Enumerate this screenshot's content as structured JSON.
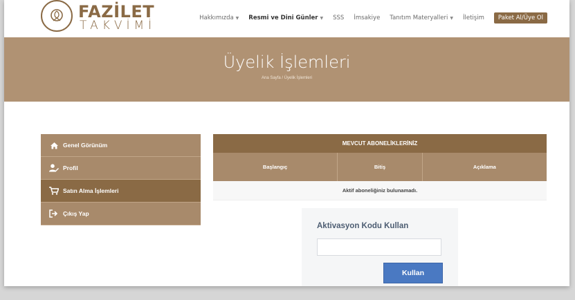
{
  "brand": {
    "title": "FAZİLET",
    "subtitle": "TAKVİMİ"
  },
  "nav": {
    "items": [
      {
        "label": "Hakkımızda",
        "dropdown": true,
        "bold": false
      },
      {
        "label": "Resmi ve Dini Günler",
        "dropdown": true,
        "bold": true
      },
      {
        "label": "SSS",
        "dropdown": false,
        "bold": false
      },
      {
        "label": "İmsakiye",
        "dropdown": false,
        "bold": false
      },
      {
        "label": "Tanıtım Materyalleri",
        "dropdown": true,
        "bold": false
      },
      {
        "label": "İletişim",
        "dropdown": false,
        "bold": false
      }
    ],
    "cta_label": "Paket Al/Üye Ol"
  },
  "hero": {
    "title": "Üyelik İşlemleri",
    "breadcrumb": "Ana Sayfa / Üyelik İşlemleri"
  },
  "sidebar": {
    "items": [
      {
        "label": "Genel Görünüm",
        "icon": "home-icon",
        "active": false
      },
      {
        "label": "Profil",
        "icon": "user-edit-icon",
        "active": false
      },
      {
        "label": "Satın Alma İşlemleri",
        "icon": "cart-icon",
        "active": true
      },
      {
        "label": "Çıkış Yap",
        "icon": "sign-out-icon",
        "active": false
      }
    ]
  },
  "subscriptions": {
    "title": "MEVCUT ABONELİKLERİNİZ",
    "columns": [
      "Başlangıç",
      "Bitiş",
      "Açıklama"
    ],
    "empty_message": "Aktif aboneliğiniz bulunamadı."
  },
  "activation": {
    "title": "Aktivasyon Kodu Kullan",
    "input_value": "",
    "button_label": "Kullan"
  },
  "colors": {
    "brand_brown": "#8a6a45",
    "hero_tan": "#b09273",
    "button_blue": "#4a79c2"
  }
}
